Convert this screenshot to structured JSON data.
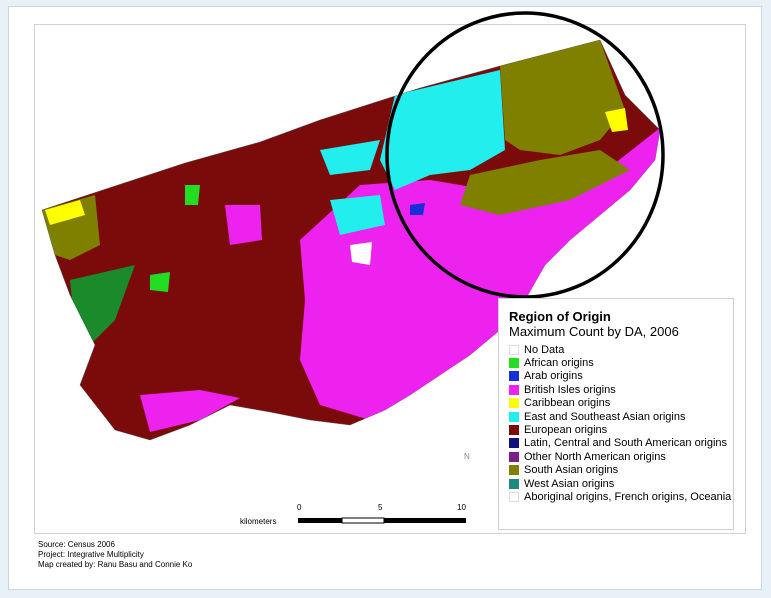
{
  "legend": {
    "title": "Region of Origin",
    "subtitle": "Maximum Count by DA, 2006",
    "items": [
      {
        "label": "No Data",
        "color": "#ffffff"
      },
      {
        "label": "African origins",
        "color": "#22dd22"
      },
      {
        "label": "Arab origins",
        "color": "#1530d8"
      },
      {
        "label": "British Isles origins",
        "color": "#ee22ee"
      },
      {
        "label": "Caribbean origins",
        "color": "#ffff00"
      },
      {
        "label": "East and Southeast Asian origins",
        "color": "#22eeee"
      },
      {
        "label": "European origins",
        "color": "#7b0a0a"
      },
      {
        "label": "Latin, Central and South American origins",
        "color": "#101080"
      },
      {
        "label": "Other North American origins",
        "color": "#7a1f86"
      },
      {
        "label": "South Asian origins",
        "color": "#7f7f00"
      },
      {
        "label": "West Asian origins",
        "color": "#1a8a80"
      },
      {
        "label": "Aboriginal origins, French origins, Oceania origins",
        "color": "#ffffff"
      }
    ]
  },
  "scale": {
    "unit_label": "kilometers",
    "ticks": [
      "0",
      "5",
      "10"
    ]
  },
  "credits": {
    "source": "Source: Census 2006",
    "project": "Project: Integrative Multiplicity",
    "author": "Map created by: Ranu Basu and Connie Ko"
  },
  "north_label": "N",
  "colors": {
    "european": "#7b0a0a",
    "british": "#ee22ee",
    "south_asian": "#7f7f00",
    "east_asian": "#22eeee",
    "green_region": "#1a8a2a",
    "african": "#22dd22",
    "caribbean": "#ffff00",
    "arab": "#1530d8",
    "annotation_ring": "#000000"
  }
}
